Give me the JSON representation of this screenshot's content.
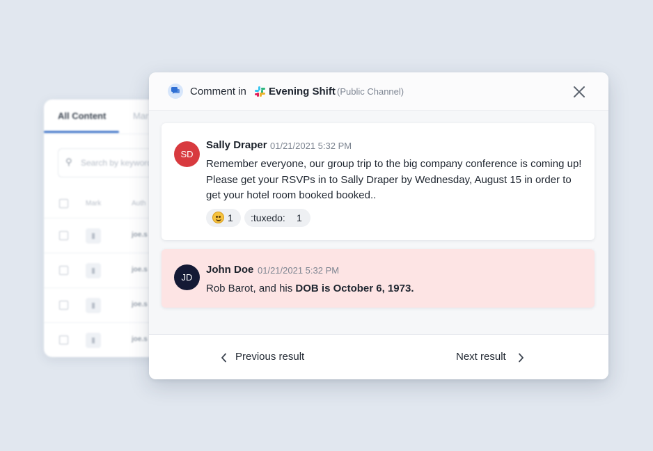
{
  "background_panel": {
    "tabs": [
      "All Content",
      "Mar"
    ],
    "search_placeholder": "Search by keyword",
    "columns": [
      "Mark",
      "Auth"
    ],
    "rows": [
      {
        "author": "joe.s"
      },
      {
        "author": "joe.s"
      },
      {
        "author": "joe.s"
      },
      {
        "author": "joe.s"
      }
    ]
  },
  "modal": {
    "header": {
      "prefix": "Comment in",
      "channel": "Evening Shift",
      "channel_type": "(Public Channel)",
      "icon": "comment-icon",
      "channel_icon": "slack-icon"
    },
    "messages": [
      {
        "initials": "SD",
        "author": "Sally Draper",
        "timestamp": "01/21/2021  5:32 PM",
        "text": "Remember everyone, our group trip to the big company conference is coming up! Please get your RSVPs in to Sally Draper by Wednesday, August 15 in order to get your hotel room booked booked..",
        "avatar_color": "#d83a3f",
        "reactions": [
          {
            "emoji": "grinning-sweat-emoji",
            "count": "1"
          },
          {
            "label": ":tuxedo:",
            "count": "1"
          }
        ]
      },
      {
        "initials": "JD",
        "author": "John Doe",
        "timestamp": "01/21/2021  5:32 PM",
        "text_plain": "Rob Barot, and his ",
        "text_bold": "DOB is October 6, 1973.",
        "avatar_color": "#141a35",
        "highlight_color": "#fde4e4"
      }
    ],
    "footer": {
      "prev_label": "Previous result",
      "next_label": "Next result"
    }
  },
  "colors": {
    "page_background": "#e1e7ef",
    "accent_tab": "#3f74c8"
  }
}
